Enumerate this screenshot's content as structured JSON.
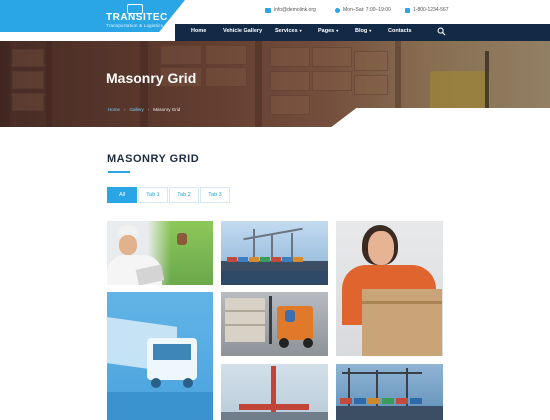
{
  "brand": {
    "title": "TRANSITEC",
    "subtitle": "Transportation & Logistics"
  },
  "contact": {
    "email": "info@demolink.org",
    "hours": "Mon–Sat: 7:00–19:00",
    "phone": "1-800-1234-567"
  },
  "nav": {
    "items": [
      {
        "label": "Home"
      },
      {
        "label": "Vehicle Gallery"
      },
      {
        "label": "Services",
        "caret": "▾"
      },
      {
        "label": "Pages",
        "caret": "▾"
      },
      {
        "label": "Blog",
        "caret": "▾"
      },
      {
        "label": "Contacts"
      }
    ]
  },
  "hero": {
    "title": "Masonry Grid",
    "breadcrumbs": [
      "Home",
      "Gallery",
      "Masonry Grid"
    ],
    "separator": "›"
  },
  "section": {
    "title": "MASONRY GRID"
  },
  "tabs": [
    {
      "label": "All",
      "active": true
    },
    {
      "label": "Tab 1",
      "active": false
    },
    {
      "label": "Tab 2",
      "active": false
    },
    {
      "label": "Tab 3",
      "active": false
    }
  ],
  "colors": {
    "accent": "#2aa6e6",
    "nav_bg": "#122a45",
    "heading": "#1d2c3f"
  },
  "icons": {
    "email": "envelope-icon",
    "hours": "clock-icon",
    "phone": "phone-icon",
    "search": "search-icon"
  }
}
